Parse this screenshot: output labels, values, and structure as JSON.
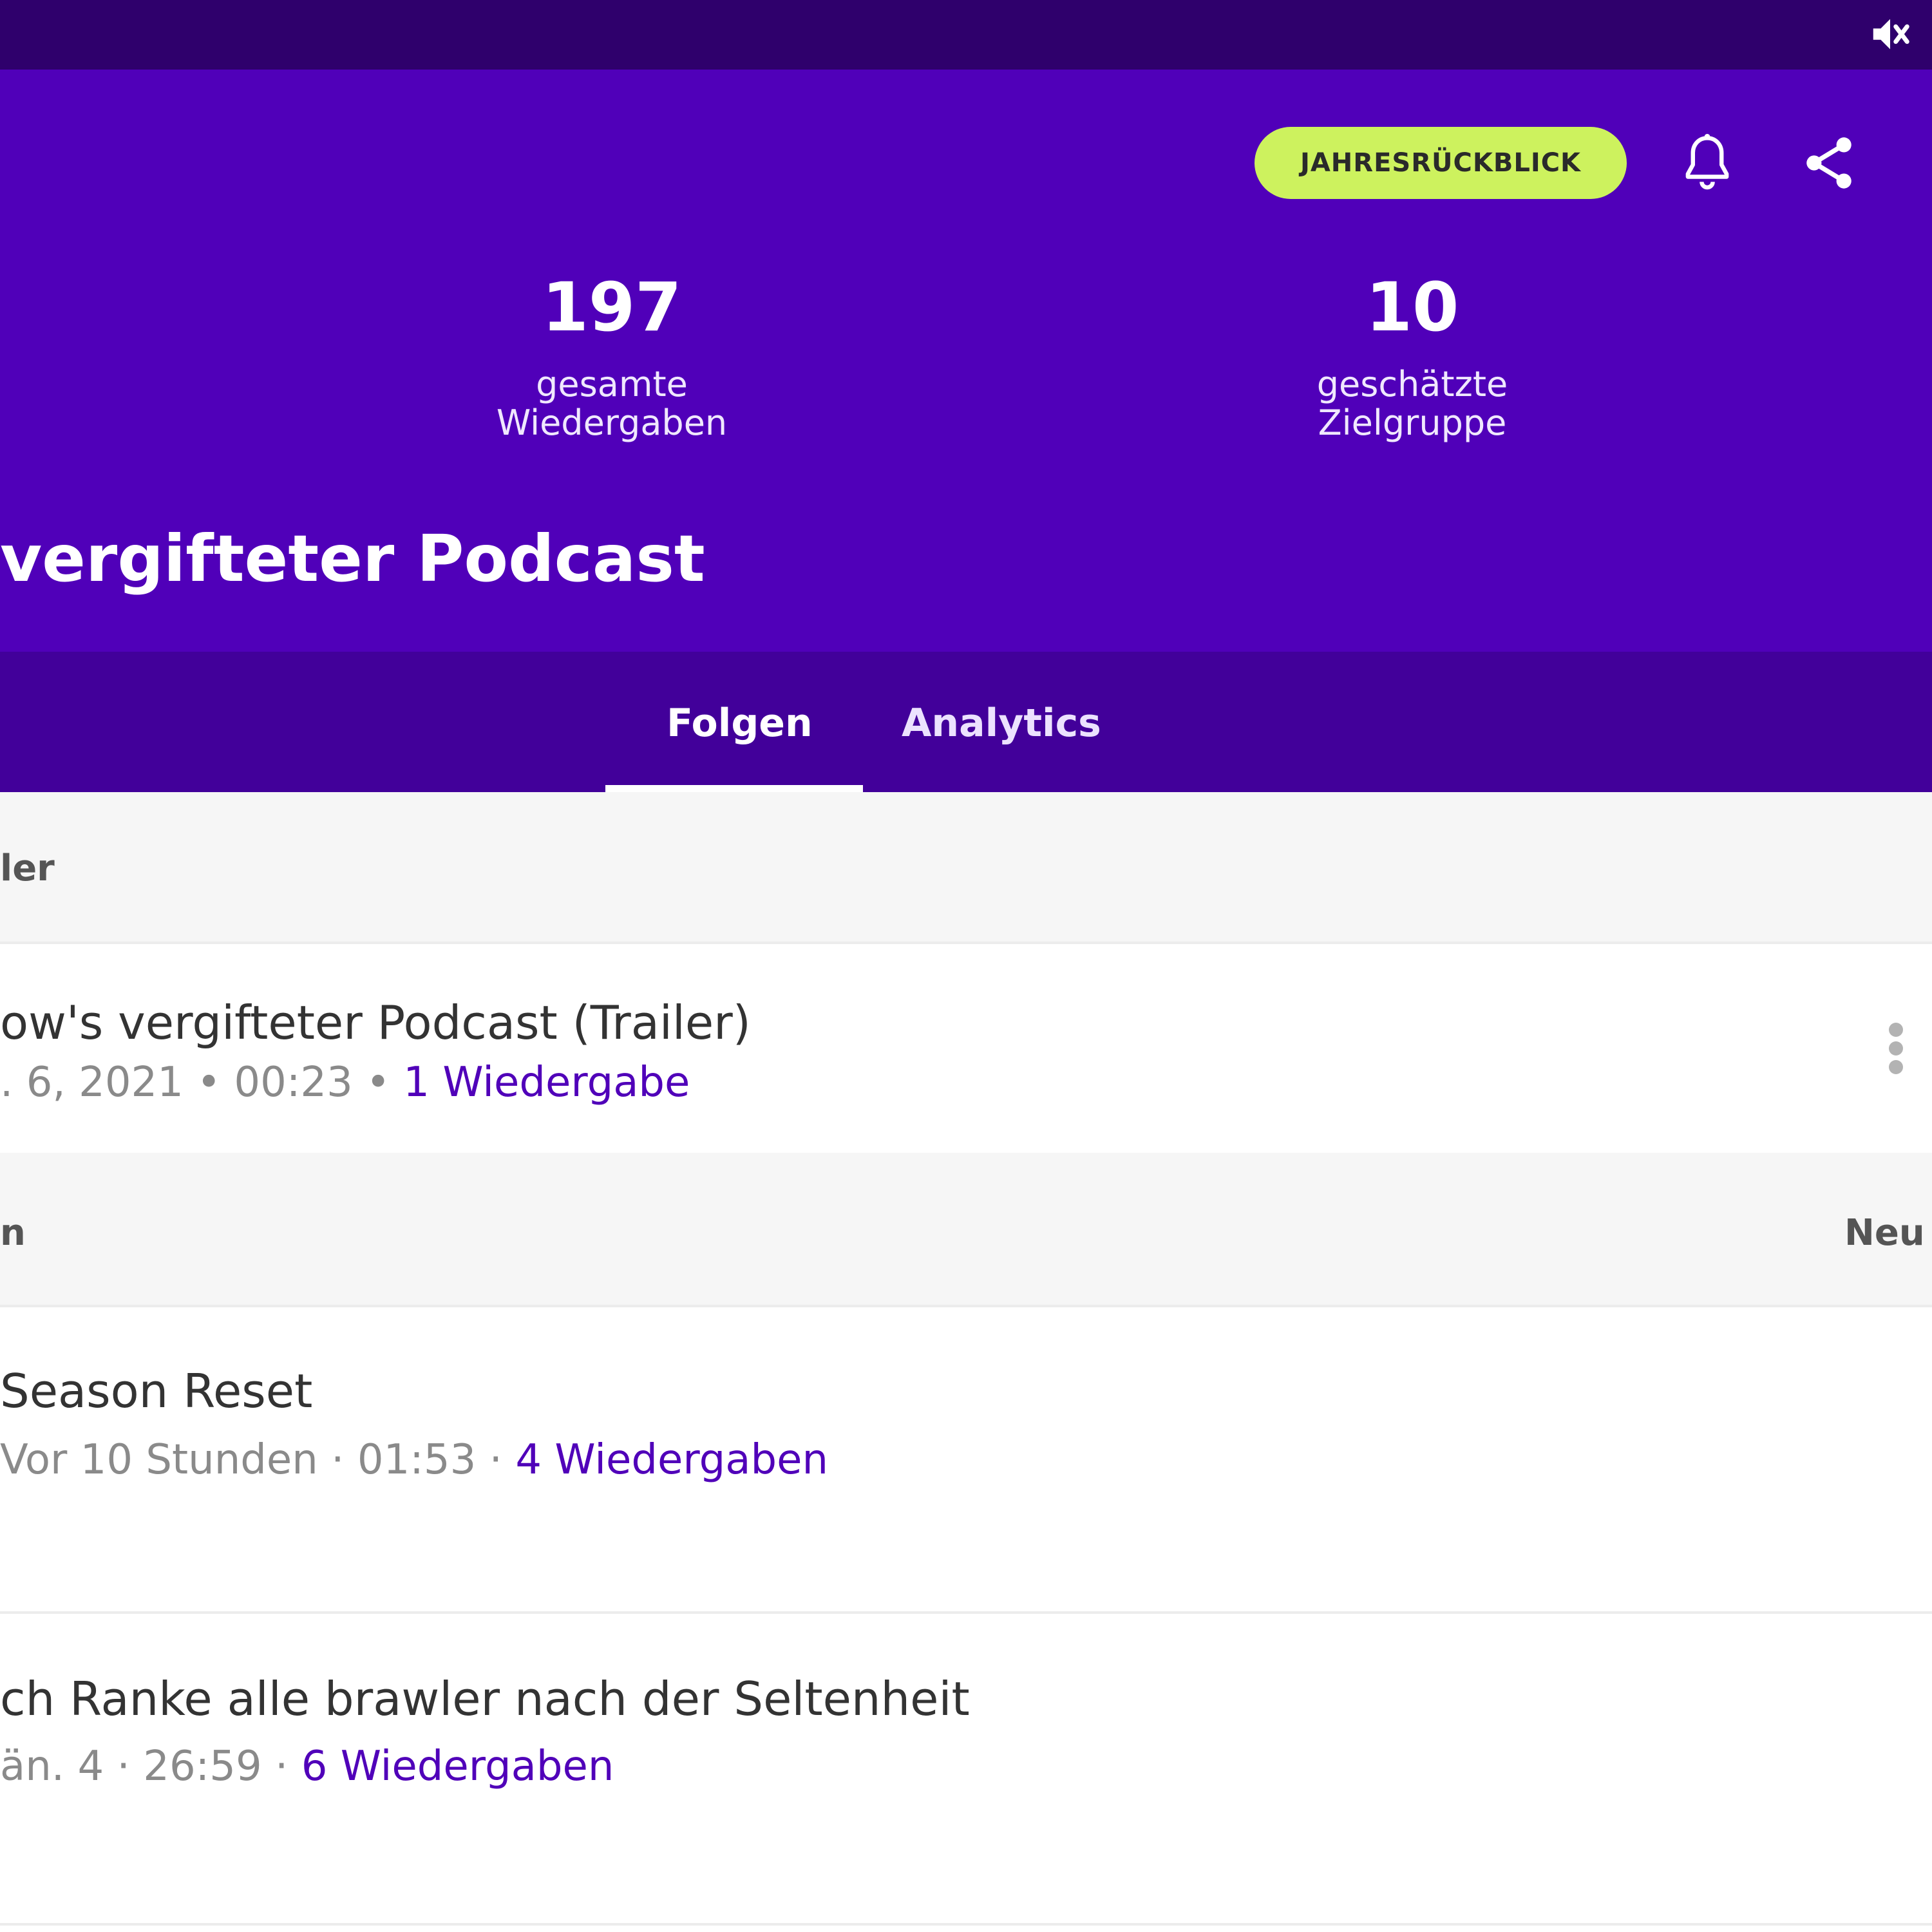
{
  "colors": {
    "status_bar": "#2f006c",
    "header": "#5000b9",
    "tab_bar": "#42009a",
    "accent_button": "#cdf25e",
    "link": "#5000b9"
  },
  "status_bar": {
    "mute_icon": "volume-off-icon"
  },
  "header": {
    "year_review_label": "JAHRESRÜCKBLICK",
    "bell_icon": "bell-icon",
    "share_icon": "share-icon",
    "stats": [
      {
        "value": "197",
        "label_line1": "gesamte",
        "label_line2": "Wiedergaben"
      },
      {
        "value": "10",
        "label_line1": "geschätzte",
        "label_line2": "Zielgruppe"
      }
    ],
    "podcast_title": "vergifteter Podcast"
  },
  "tabs": [
    {
      "label": "Folgen",
      "selected": true
    },
    {
      "label": "Analytics",
      "selected": false
    }
  ],
  "trailer_section": {
    "heading": "ler",
    "episode": {
      "title": "ow's vergifteter Podcast  (Trailer)",
      "date": ". 6, 2021",
      "duration": "00:23",
      "plays": "1 Wiedergabe"
    }
  },
  "episodes_section": {
    "heading": "n",
    "sort_label": "Neu",
    "episodes": [
      {
        "title": "Season Reset",
        "date": "Vor 10 Stunden",
        "duration": "01:53",
        "plays": "4 Wiedergaben"
      },
      {
        "title": "ch Ranke alle brawler nach der Seltenheit",
        "date": "än. 4",
        "duration": "26:59",
        "plays": "6 Wiedergaben"
      }
    ]
  }
}
